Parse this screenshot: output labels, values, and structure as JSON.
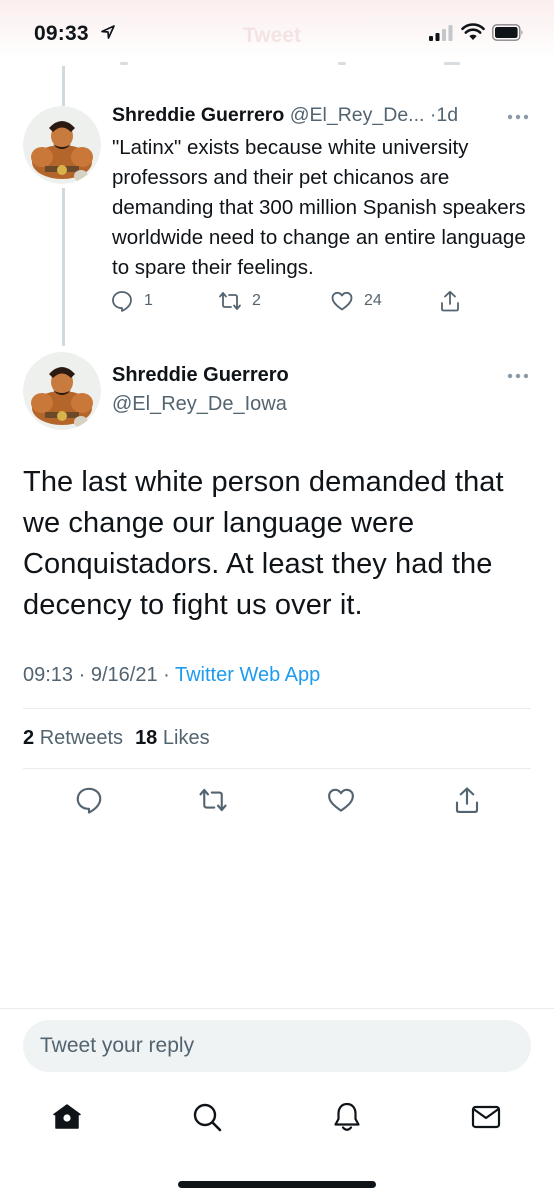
{
  "status_bar": {
    "time": "09:33",
    "header_title": "Tweet"
  },
  "parent_tweet": {
    "author_name": "Shreddie Guerrero",
    "author_handle": "@El_Rey_De...",
    "separator": "·",
    "timestamp": "1d",
    "text": "\"Latinx\" exists because white university professors and their pet chicanos are demanding that 300 million Spanish speakers worldwide need to change an entire language to spare their feelings.",
    "reply_count": "1",
    "retweet_count": "2",
    "like_count": "24"
  },
  "main_tweet": {
    "author_name": "Shreddie Guerrero",
    "author_handle": "@El_Rey_De_Iowa",
    "text": "The last white person demanded that we change our language were Conquistadors. At least they had the decency to fight us over it.",
    "time": "09:13",
    "date": "9/16/21",
    "meta_separator": " · ",
    "source": "Twitter Web App",
    "retweets_count": "2",
    "retweets_label": "Retweets",
    "likes_count": "18",
    "likes_label": "Likes"
  },
  "reply_box": {
    "placeholder": "Tweet your reply"
  },
  "colors": {
    "accent": "#1d9bf0",
    "secondary_text": "#536471",
    "primary_text": "#0f1419"
  },
  "icons": {
    "tab_bar": [
      "home-icon",
      "search-icon",
      "notifications-icon",
      "messages-icon"
    ],
    "actions": [
      "reply-icon",
      "retweet-icon",
      "like-icon",
      "share-icon"
    ]
  }
}
